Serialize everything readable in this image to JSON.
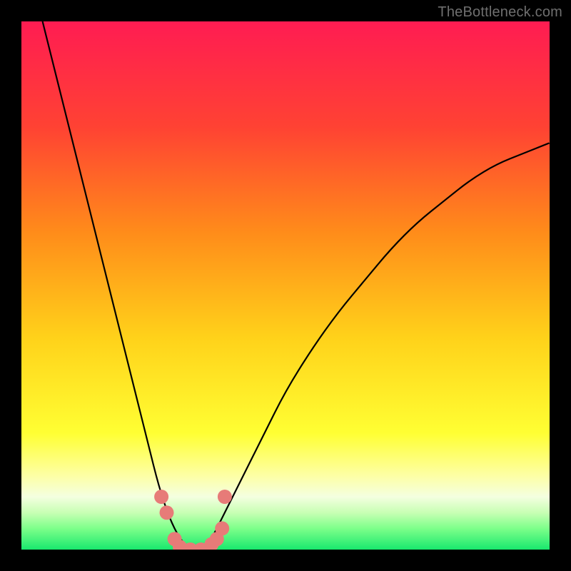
{
  "watermark": "TheBottleneck.com",
  "chart_data": {
    "type": "line",
    "title": "",
    "xlabel": "",
    "ylabel": "",
    "xlim": [
      0,
      100
    ],
    "ylim": [
      0,
      100
    ],
    "gradient_stops": [
      {
        "offset": 0,
        "color": "#ff1c52"
      },
      {
        "offset": 20,
        "color": "#ff4233"
      },
      {
        "offset": 40,
        "color": "#ff8c1a"
      },
      {
        "offset": 60,
        "color": "#ffd21a"
      },
      {
        "offset": 78,
        "color": "#ffff33"
      },
      {
        "offset": 86,
        "color": "#fdffa5"
      },
      {
        "offset": 90,
        "color": "#f4ffe0"
      },
      {
        "offset": 93,
        "color": "#c8ffb4"
      },
      {
        "offset": 96,
        "color": "#7dff8a"
      },
      {
        "offset": 100,
        "color": "#19e86e"
      }
    ],
    "series": [
      {
        "name": "bottleneck-curve",
        "x": [
          4,
          6,
          8,
          10,
          12,
          14,
          16,
          18,
          20,
          22,
          24,
          26,
          28,
          30,
          32,
          34,
          36,
          38,
          42,
          46,
          50,
          55,
          60,
          65,
          70,
          75,
          80,
          85,
          90,
          95,
          100
        ],
        "y": [
          100,
          92,
          84,
          76,
          68,
          60,
          52,
          44,
          36,
          28,
          20,
          12,
          6,
          2,
          0,
          0,
          2,
          6,
          14,
          22,
          30,
          38,
          45,
          51,
          57,
          62,
          66,
          70,
          73,
          75,
          77
        ]
      }
    ],
    "markers": {
      "name": "highlight-dots",
      "color": "#e77b78",
      "radius": 10,
      "points": [
        {
          "x": 26.5,
          "y": 10
        },
        {
          "x": 27.5,
          "y": 7
        },
        {
          "x": 29,
          "y": 2
        },
        {
          "x": 30,
          "y": 0.5
        },
        {
          "x": 32,
          "y": 0
        },
        {
          "x": 34,
          "y": 0
        },
        {
          "x": 36,
          "y": 1
        },
        {
          "x": 37,
          "y": 2
        },
        {
          "x": 38,
          "y": 4
        },
        {
          "x": 38.5,
          "y": 10
        }
      ]
    }
  }
}
